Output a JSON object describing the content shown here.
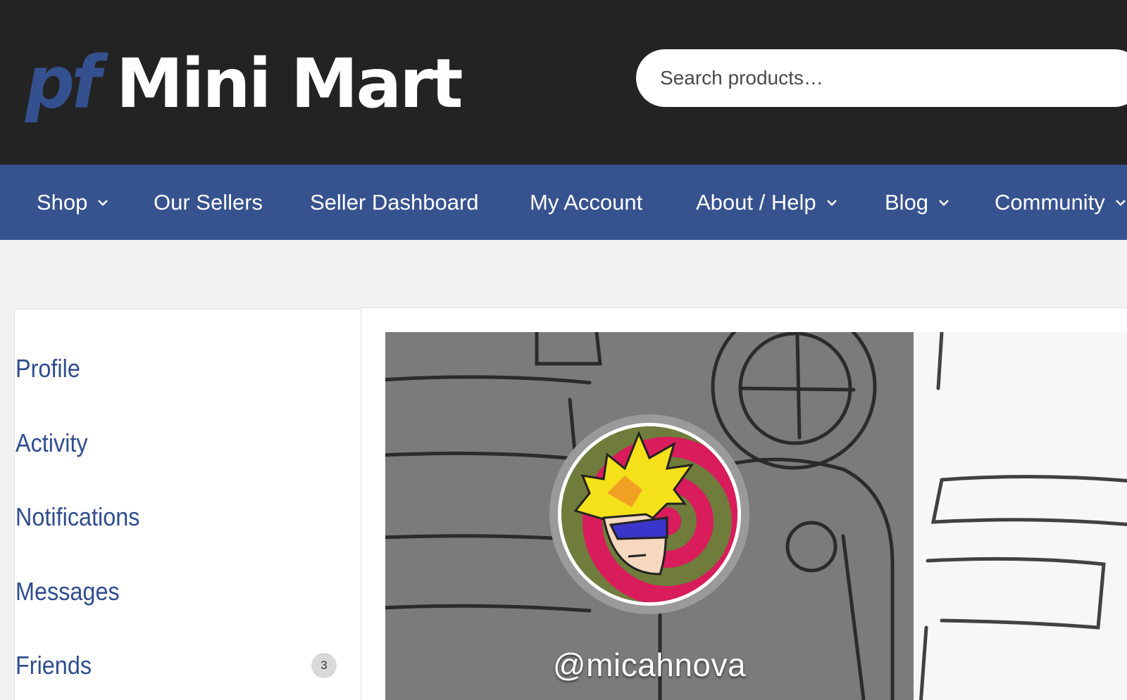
{
  "header": {
    "logo_prefix": "pf",
    "logo_name": "Mini Mart",
    "search_placeholder": "Search products…"
  },
  "nav": {
    "items": [
      {
        "label": "Shop",
        "has_dropdown": true
      },
      {
        "label": "Our Sellers",
        "has_dropdown": false
      },
      {
        "label": "Seller Dashboard",
        "has_dropdown": false
      },
      {
        "label": "My Account",
        "has_dropdown": false
      },
      {
        "label": "About / Help",
        "has_dropdown": true
      },
      {
        "label": "Blog",
        "has_dropdown": true
      },
      {
        "label": "Community",
        "has_dropdown": true
      }
    ]
  },
  "sidebar": {
    "items": [
      {
        "label": "Profile"
      },
      {
        "label": "Activity"
      },
      {
        "label": "Notifications"
      },
      {
        "label": "Messages"
      },
      {
        "label": "Friends",
        "badge": "3"
      }
    ]
  },
  "profile": {
    "username": "@micahnova"
  },
  "colors": {
    "header_bg": "#232323",
    "nav_bg": "#37538f",
    "logo_accent": "#34508f",
    "sidebar_link": "#2f4d8f",
    "page_bg": "#f2f2f2"
  }
}
